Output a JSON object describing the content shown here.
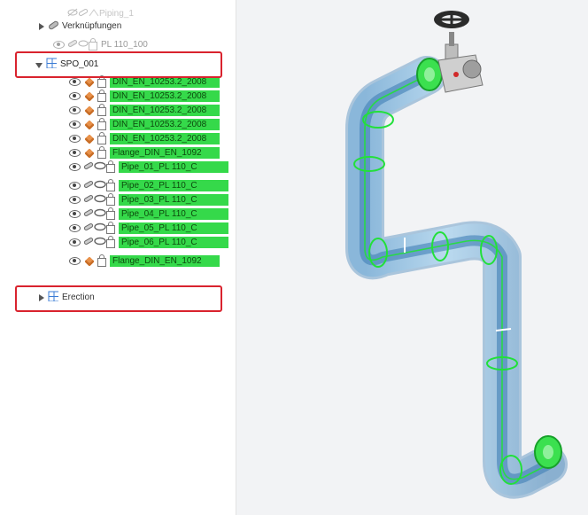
{
  "tree": {
    "top_item": "Piping_1",
    "links_label": "Verknüpfungen",
    "link_child": "PL 110_100",
    "group_label": "SPO_001",
    "children": [
      {
        "label": "DIN_EN_10253.2_2008",
        "kind": "part"
      },
      {
        "label": "DIN_EN_10253.2_2008",
        "kind": "part"
      },
      {
        "label": "DIN_EN_10253.2_2008",
        "kind": "part"
      },
      {
        "label": "DIN_EN_10253.2_2008",
        "kind": "part"
      },
      {
        "label": "DIN_EN_10253.2_2008",
        "kind": "part"
      },
      {
        "label": "Flange_DIN_EN_1092",
        "kind": "part"
      },
      {
        "label": "Pipe_01_PL 110_C",
        "kind": "pipe"
      },
      {
        "label": "Pipe_02_PL 110_C",
        "kind": "pipe"
      },
      {
        "label": "Pipe_03_PL 110_C",
        "kind": "pipe"
      },
      {
        "label": "Pipe_04_PL 110_C",
        "kind": "pipe"
      },
      {
        "label": "Pipe_05_PL 110_C",
        "kind": "pipe"
      },
      {
        "label": "Pipe_06_PL 110_C",
        "kind": "pipe"
      },
      {
        "label": "Flange_DIN_EN_1092",
        "kind": "part"
      }
    ],
    "erection_label": "Erection"
  },
  "colors": {
    "highlight": "#35d94a",
    "annotation_box": "#d9232e",
    "pipe_fill": "#9cc7e6",
    "pipe_edge": "#22e03a"
  }
}
